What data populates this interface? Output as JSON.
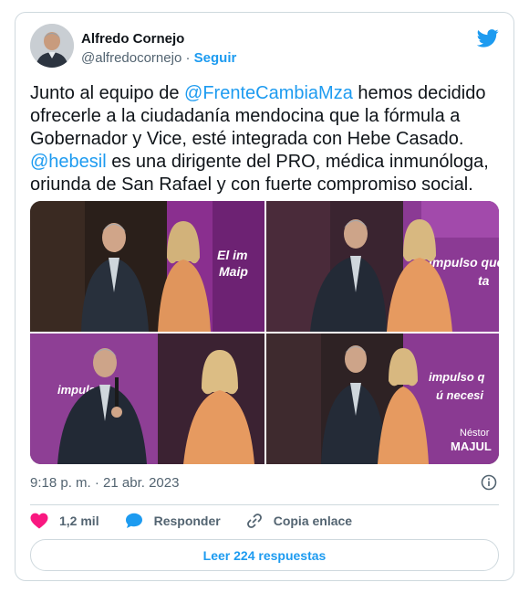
{
  "author": {
    "name": "Alfredo Cornejo",
    "handle": "@alfredocornejo",
    "separator": "·",
    "follow_label": "Seguir"
  },
  "tweet": {
    "t1": "Junto al equipo de ",
    "m1": "@FrenteCambiaMza",
    "t2": " hemos decidido ofrecerle a la ciudadanía mendocina que la fórmula a Gobernador y Vice, esté integrada con Hebe Casado.",
    "m2": "@hebesil",
    "t3": " es una dirigente del PRO, médica inmunóloga, oriunda de San Rafael y con fuerte compromiso social."
  },
  "photos": [
    {
      "banner": "El im\nMaip"
    },
    {
      "banner": "impulso que\nta"
    },
    {
      "banner": "impulso\nnecesi"
    },
    {
      "banner": "impulso q\nú necesi"
    }
  ],
  "banner_name": "Néstor\nMAJUL",
  "timestamp": "9:18 p. m. · 21 abr. 2023",
  "actions": {
    "likes": "1,2 mil",
    "reply_label": "Responder",
    "copy_label": "Copia enlace"
  },
  "read_replies": "Leer 224 respuestas",
  "colors": {
    "accent": "#1d9bf0",
    "like": "#f91880",
    "text": "#0f1419",
    "muted": "#536471",
    "border": "#cfd9de"
  }
}
